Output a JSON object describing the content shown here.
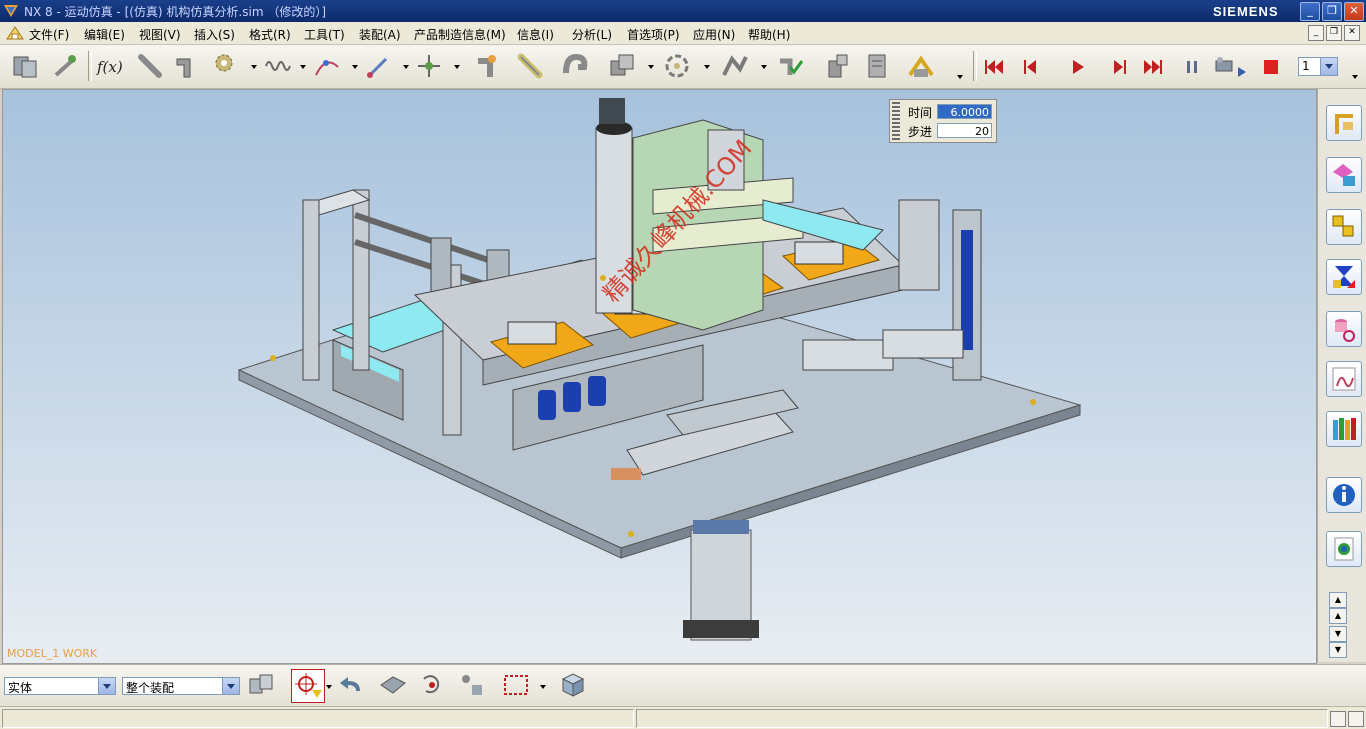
{
  "window": {
    "title": "NX 8 - 运动仿真 - [(仿真) 机构仿真分析.sim （修改的）]",
    "brand": "SIEMENS",
    "minimize": "_",
    "restore": "❐",
    "close": "✕"
  },
  "menu": [
    {
      "label": "文件(F)"
    },
    {
      "label": "编辑(E)"
    },
    {
      "label": "视图(V)"
    },
    {
      "label": "插入(S)"
    },
    {
      "label": "格式(R)"
    },
    {
      "label": "工具(T)"
    },
    {
      "label": "装配(A)"
    },
    {
      "label": "产品制造信息(M)"
    },
    {
      "label": "信息(I)"
    },
    {
      "label": "分析(L)"
    },
    {
      "label": "首选项(P)"
    },
    {
      "label": "应用(N)"
    },
    {
      "label": "帮助(H)"
    }
  ],
  "playback": {
    "step_select_value": "1"
  },
  "viewport": {
    "label": "MODEL_1 WORK",
    "watermark": "精诚久峰机械.COM"
  },
  "animation_panel": {
    "time_label": "时间",
    "time_value": "6.0000",
    "step_label": "步进",
    "step_value": "20"
  },
  "filters": {
    "type_value": "实体",
    "scope_value": "整个装配"
  },
  "colors": {
    "title_bar": "#1a3f8a",
    "viewport_top": "#a7c2dd",
    "viewport_bottom": "#e8edf2",
    "accent_orange": "#e8a040",
    "watermark_red": "#d42a1a"
  }
}
